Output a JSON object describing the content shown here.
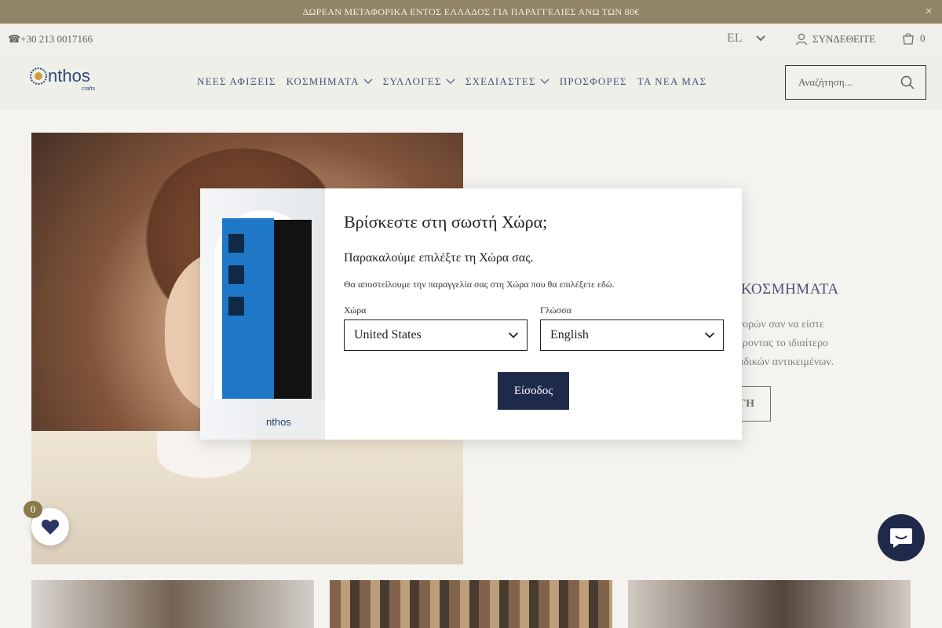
{
  "announcement": {
    "text": "ΔΩΡΕΑΝ ΜΕΤΑΦΟΡΙΚΑ ΕΝΤΟΣ ΕΛΛΑΔΟΣ ΓΙΑ ΠΑΡΑΓΓΕΛΙΕΣ ΑΝΩ ΤΩΝ 80€",
    "close": "×"
  },
  "topbar": {
    "phone": "☎+30 213 0017166",
    "language": "EL",
    "login": "ΣΥΝΔΕΘΕΙΤΕ",
    "cart_count": "0"
  },
  "header": {
    "logo_main": "nthos",
    "logo_sub": "crafts",
    "nav": [
      {
        "label": "ΝΕΕΣ ΑΦΙΞΕΙΣ"
      },
      {
        "label": "ΚΟΣΜΗΜΑΤΑ"
      },
      {
        "label": "ΣΥΛΛΟΓΕΣ"
      },
      {
        "label": "ΣΧΕΔΙΑΣΤΕΣ"
      },
      {
        "label": "ΠΡΟΣΦΟΡΕΣ"
      },
      {
        "label": "ΤΑ ΝΕΑ ΜΑΣ"
      }
    ],
    "search_placeholder": "Αναζήτηση..."
  },
  "hero": {
    "heading_fragment": "ΚΟΣΜΗΜΑΤΑ",
    "desc_line1": "γορών σαν να είστε",
    "desc_line2": "έροντας το ιδιαίτερο",
    "desc_line3": "αδικών αντικειμένων.",
    "button_fragment": "ΓΗ"
  },
  "modal": {
    "title": "Βρίσκεστε στη σωστή Χώρα;",
    "subtitle": "Παρακαλούμε επιλέξτε τη Χώρα σας.",
    "note": "Θα αποστείλουμε την παραγγελία σας στη Χώρα που θα επιλέξετε εδώ.",
    "country_label": "Χώρα",
    "country_value": "United States",
    "language_label": "Γλώσσα",
    "language_value": "English",
    "submit_label": "Είσοδος",
    "image_logo": "nthos"
  },
  "wishlist": {
    "count": "0"
  },
  "colors": {
    "announce_bg": "#8a7f5e",
    "brand_navy": "#1f2a4a",
    "door_blue": "#1f78c7"
  }
}
